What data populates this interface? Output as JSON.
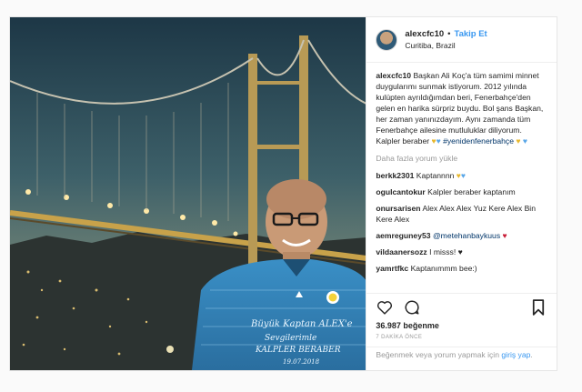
{
  "post": {
    "username": "alexcfc10",
    "follow_label": "Takip Et",
    "separator": "•",
    "location": "Curitiba, Brazil",
    "caption_username": "alexcfc10",
    "caption_text": "Başkan Ali Koç'a tüm samimi minnet duygularımı sunmak istiyorum. 2012 yılında kulüpten ayrıldığımdan beri, Fenerbahçe'den gelen en harika sürpriz buydu. Bol şans Başkan, her zaman yanınızdayım. Aynı zamanda tüm Fenerbahçe ailesine mutluluklar diliyorum. Kalpler beraber",
    "caption_hashtag": "#yenidenfenerbahçe",
    "load_more": "Daha fazla yorum yükle",
    "comments": [
      {
        "user": "berkk2301",
        "text": "Kaptannnn"
      },
      {
        "user": "ogulcantokur",
        "text": "Kalpler beraber kaptanım"
      },
      {
        "user": "onursarisen",
        "text": "Alex Alex Alex Yuz Kere Alex Bin Kere Alex"
      },
      {
        "user": "aemreguney53",
        "mention": "@metehanbaykuus",
        "text": ""
      },
      {
        "user": "vildaanersozz",
        "text": "I misss!"
      },
      {
        "user": "yamrtfkc",
        "text": "Kaptanımmm bee:)"
      }
    ],
    "likes": "36.987 beğenme",
    "time": "7 DAKİKA ÖNCE",
    "add_comment_text": "Beğenmek veya yorum yapmak için",
    "login_link": "giriş yap",
    "login_suffix": "."
  },
  "colors": {
    "link_blue": "#3897f0",
    "hashtag_blue": "#003569",
    "muted_gray": "#999999",
    "border": "#efefef"
  },
  "icons": [
    "heart-icon",
    "comment-icon",
    "bookmark-icon"
  ],
  "photo_jersey": {
    "line1": "Büyük Kaptan ALEX'e",
    "line2": "Sevgilerimle",
    "line3": "KALPLER BERABER",
    "date": "19.07.2018"
  }
}
